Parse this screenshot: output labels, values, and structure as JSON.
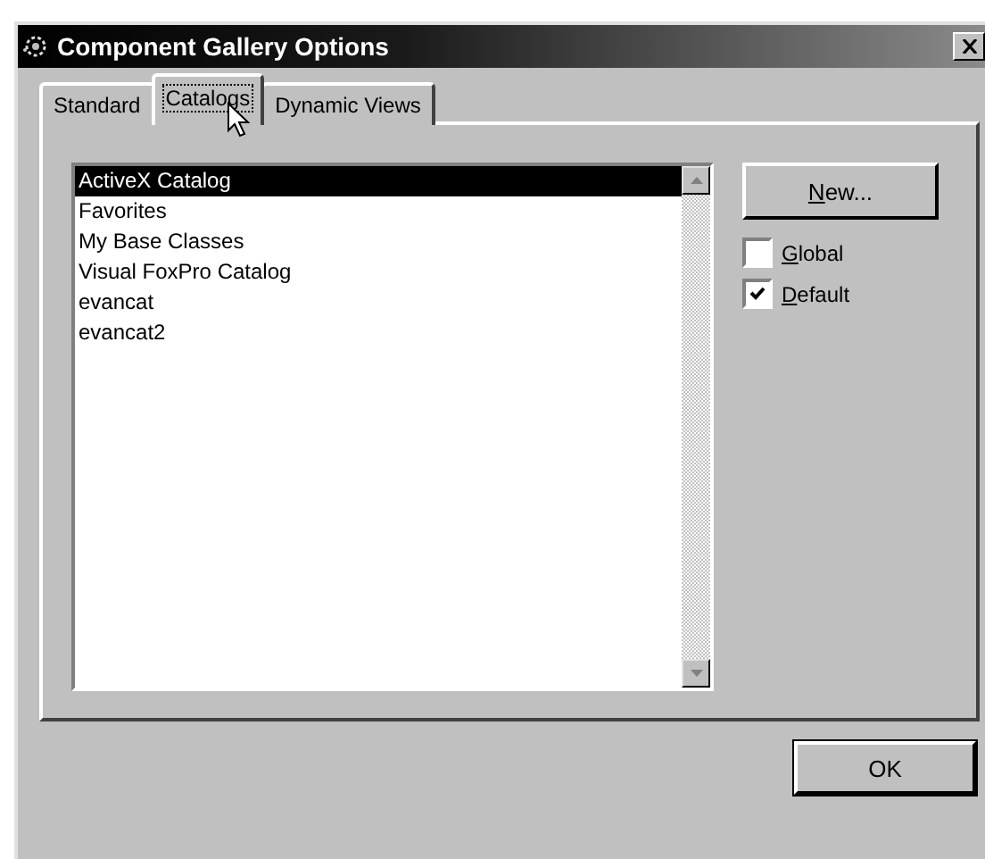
{
  "window": {
    "title": "Component Gallery Options"
  },
  "tabs": [
    {
      "label": "Standard",
      "selected": false
    },
    {
      "label": "Catalogs",
      "selected": true
    },
    {
      "label": "Dynamic Views",
      "selected": false
    }
  ],
  "catalogs": [
    {
      "label": "ActiveX Catalog",
      "selected": true
    },
    {
      "label": "Favorites",
      "selected": false
    },
    {
      "label": "My Base Classes",
      "selected": false
    },
    {
      "label": "Visual FoxPro Catalog",
      "selected": false
    },
    {
      "label": "evancat",
      "selected": false
    },
    {
      "label": "evancat2",
      "selected": false
    }
  ],
  "new_button": "New...",
  "options": [
    {
      "label": "Global",
      "checked": false
    },
    {
      "label": "Default",
      "checked": true
    }
  ],
  "ok_button": "OK"
}
